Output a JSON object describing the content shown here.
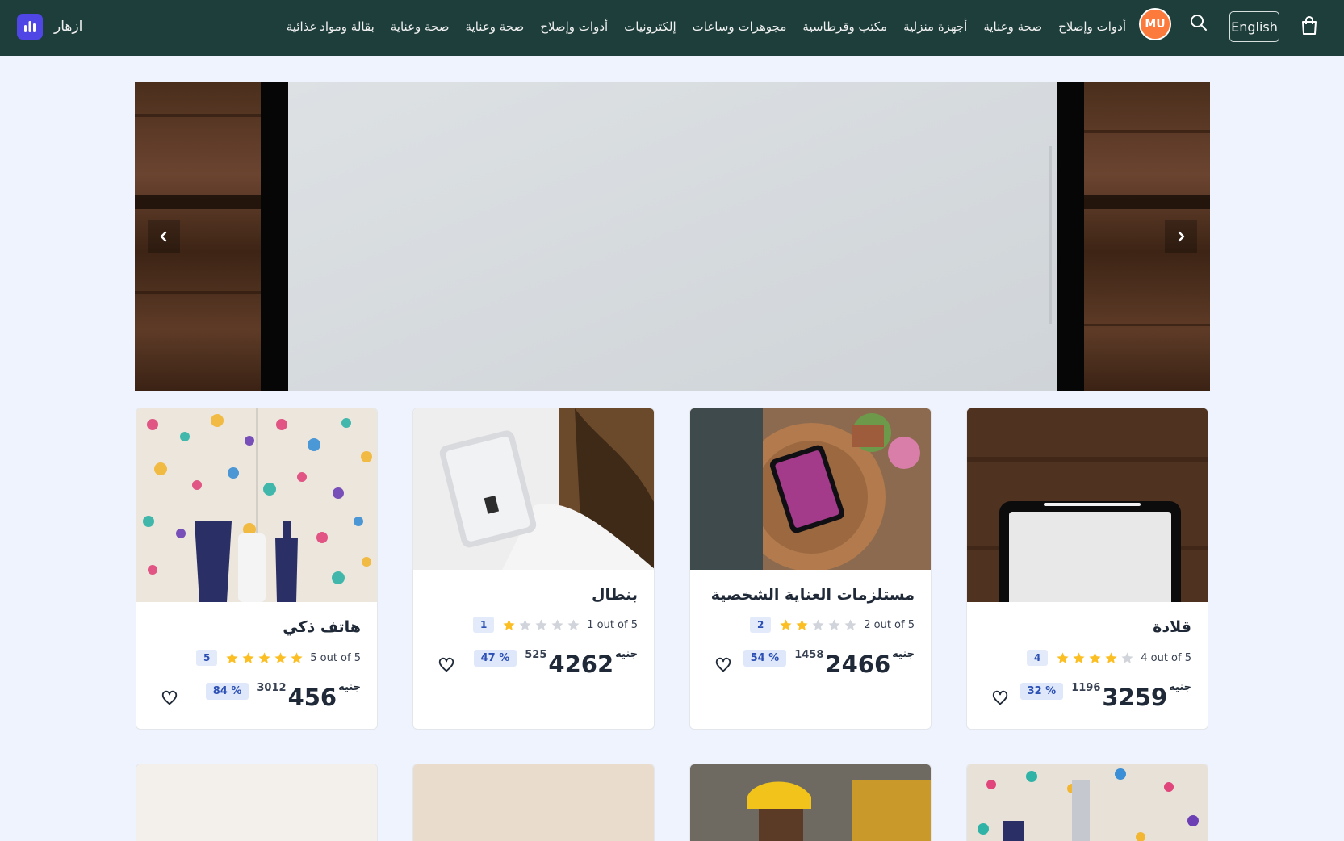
{
  "navbar": {
    "brand_name": "ازهار",
    "language_label": "English",
    "avatar_initials": "MU",
    "links": [
      "بقالة ومواد غذائية",
      "صحة وعناية",
      "صحة وعناية",
      "أدوات وإصلاح",
      "إلكترونيات",
      "مجوهرات وساعات",
      "مكتب وقرطاسية",
      "أجهزة منزلية",
      "صحة وعناية",
      "أدوات وإصلاح"
    ],
    "icons": [
      "cart-icon",
      "search-icon",
      "bar-chart-logo-icon"
    ]
  },
  "hero": {
    "prev_icon": "chevron-left-icon",
    "next_icon": "chevron-right-icon"
  },
  "products": [
    {
      "title": "قلادة",
      "rating_text": "4 out of 5",
      "rating": 4,
      "rating_count": "4",
      "currency": "جنيه",
      "price": "3259",
      "old_price": "1196",
      "discount": "32 %"
    },
    {
      "title": "مستلزمات العناية الشخصية",
      "rating_text": "2 out of 5",
      "rating": 2,
      "rating_count": "2",
      "currency": "جنيه",
      "price": "2466",
      "old_price": "1458",
      "discount": "54 %"
    },
    {
      "title": "بنطال",
      "rating_text": "1 out of 5",
      "rating": 1,
      "rating_count": "1",
      "currency": "جنيه",
      "price": "4262",
      "old_price": "525",
      "discount": "47 %"
    },
    {
      "title": "هاتف ذكي",
      "rating_text": "5 out of 5",
      "rating": 5,
      "rating_count": "5",
      "currency": "جنيه",
      "price": "456",
      "old_price": "3012",
      "discount": "84 %"
    }
  ],
  "colors": {
    "navbar_bg": "#1d3e3b",
    "page_bg": "#eef3fd",
    "star_filled": "#fbbf24",
    "star_empty": "#d1d5db",
    "badge_bg": "#dfe8fb",
    "badge_text": "#2c50b4",
    "avatar_bg": "#fb7a3c"
  }
}
